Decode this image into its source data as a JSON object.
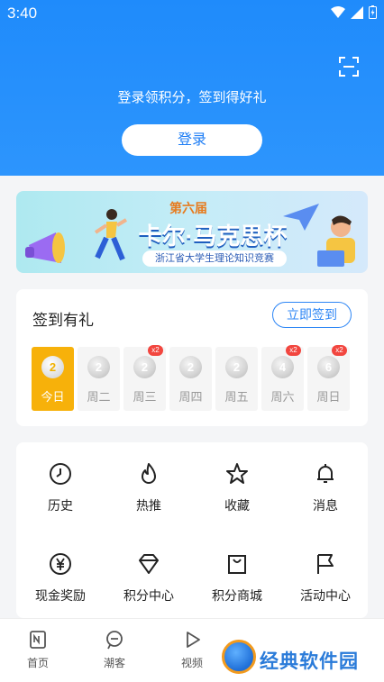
{
  "status": {
    "time": "3:40"
  },
  "header": {
    "prompt": "登录领积分，签到得好礼",
    "login_label": "登录"
  },
  "banner": {
    "edition": "第六届",
    "title": "卡尔·马克思杯",
    "subtitle": "浙江省大学生理论知识竞赛"
  },
  "checkin": {
    "title": "签到有礼",
    "button_label": "立即签到",
    "days": [
      {
        "label": "今日",
        "points": "2",
        "badge": ""
      },
      {
        "label": "周二",
        "points": "2",
        "badge": ""
      },
      {
        "label": "周三",
        "points": "2",
        "badge": "x2"
      },
      {
        "label": "周四",
        "points": "2",
        "badge": ""
      },
      {
        "label": "周五",
        "points": "2",
        "badge": ""
      },
      {
        "label": "周六",
        "points": "4",
        "badge": "x2"
      },
      {
        "label": "周日",
        "points": "6",
        "badge": "x2"
      }
    ]
  },
  "grid": {
    "items": [
      {
        "label": "历史",
        "icon": "clock-icon"
      },
      {
        "label": "热推",
        "icon": "flame-icon"
      },
      {
        "label": "收藏",
        "icon": "star-icon"
      },
      {
        "label": "消息",
        "icon": "bell-icon"
      },
      {
        "label": "现金奖励",
        "icon": "yen-icon"
      },
      {
        "label": "积分中心",
        "icon": "diamond-icon"
      },
      {
        "label": "积分商城",
        "icon": "shopping-bag-icon"
      },
      {
        "label": "活动中心",
        "icon": "flag-icon"
      }
    ]
  },
  "tabbar": {
    "items": [
      {
        "label": "首页"
      },
      {
        "label": "潮客"
      },
      {
        "label": "视频"
      }
    ]
  },
  "watermark": {
    "text": "经典软件园"
  },
  "colors": {
    "primary": "#1f8bfb",
    "accent": "#f7b10a",
    "badge": "#f2463f"
  }
}
